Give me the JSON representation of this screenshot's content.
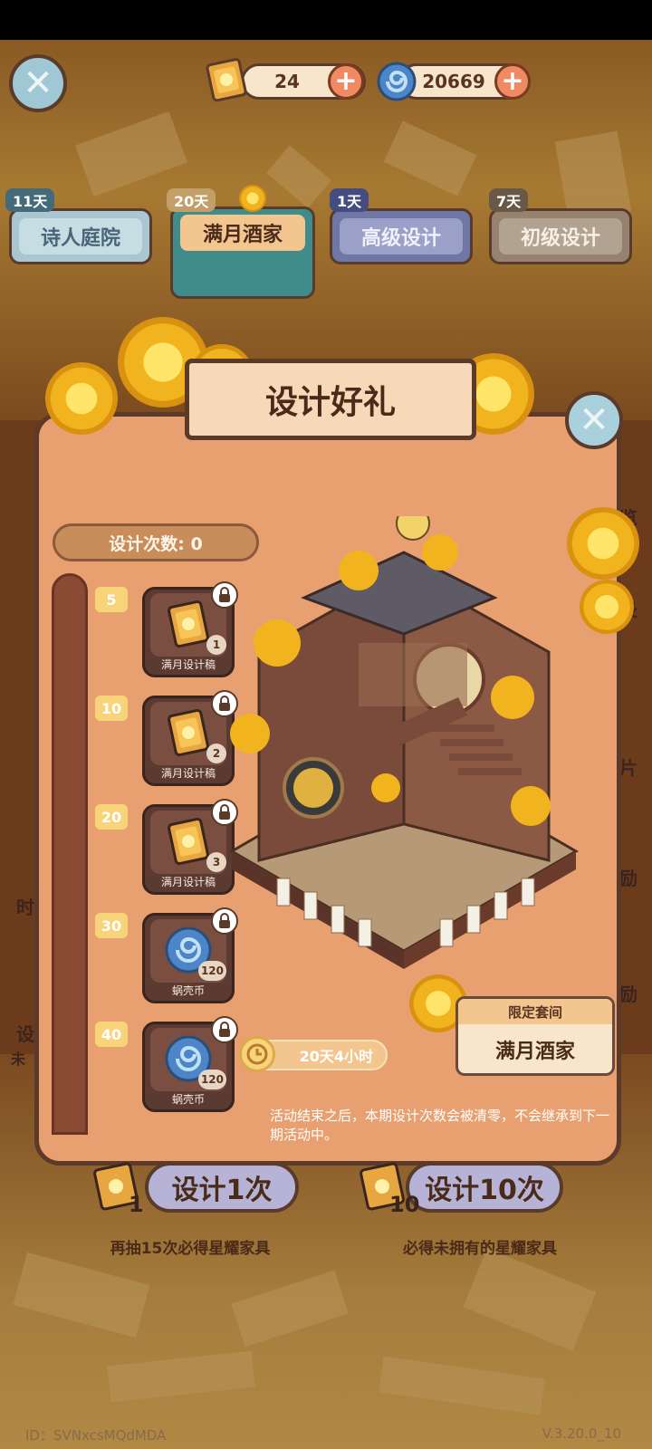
{
  "header": {
    "tickets": {
      "icon": "scroll-ticket-icon",
      "value": "24"
    },
    "shells": {
      "icon": "snail-shell-coin-icon",
      "value": "20669"
    }
  },
  "tabs": [
    {
      "badge": "11天",
      "label": "诗人庭院",
      "active": false
    },
    {
      "badge": "20天",
      "label": "满月酒家",
      "active": true
    },
    {
      "badge": "1天",
      "label": "高级设计",
      "active": false
    },
    {
      "badge": "7天",
      "label": "初级设计",
      "active": false
    }
  ],
  "panel": {
    "title": "设计好礼",
    "count_label": "设计次数: 0",
    "progress_fraction": 0,
    "rewards": [
      {
        "milestone": "5",
        "name": "满月设计稿",
        "qty": "1",
        "icon": "scroll-ticket-icon",
        "locked": true
      },
      {
        "milestone": "10",
        "name": "满月设计稿",
        "qty": "2",
        "icon": "scroll-ticket-icon",
        "locked": true
      },
      {
        "milestone": "20",
        "name": "满月设计稿",
        "qty": "3",
        "icon": "scroll-ticket-icon",
        "locked": true
      },
      {
        "milestone": "30",
        "name": "蜗壳币",
        "qty": "120",
        "icon": "snail-shell-coin-icon",
        "locked": true
      },
      {
        "milestone": "40",
        "name": "蜗壳币",
        "qty": "120",
        "icon": "snail-shell-coin-icon",
        "locked": true
      }
    ],
    "timer": "20天4小时",
    "limited_label": "限定套间",
    "limited_value": "满月酒家",
    "notice": "活动结束之后，本期设计次数会被清零，不会继承到下一期活动中。"
  },
  "actions": {
    "design_one": {
      "label": "设计1次",
      "count": "1",
      "sub": "再抽15次必得星耀家具"
    },
    "design_ten": {
      "label": "设计10次",
      "count": "10",
      "sub": "必得未拥有的星耀家具"
    }
  },
  "side": {
    "right": [
      "览",
      "录",
      "片",
      "励",
      "励"
    ],
    "left": [
      "时",
      "设",
      "未"
    ]
  },
  "footer": {
    "id": "ID：SVNxcsMQdMDA",
    "version": "V.3.20.0_10"
  },
  "colors": {
    "panel": "#e8a070",
    "accent": "#f7d47a",
    "dark": "#5b3a2a"
  }
}
